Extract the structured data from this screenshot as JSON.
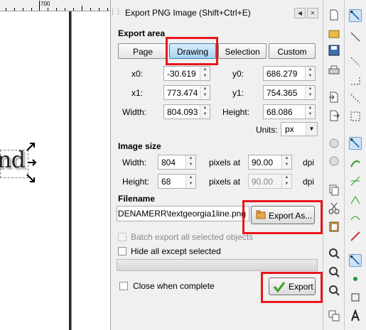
{
  "canvas": {
    "ruler_label": "700",
    "text": "nd"
  },
  "dialog": {
    "title": "Export PNG Image (Shift+Ctrl+E)",
    "export_area": {
      "heading": "Export area",
      "buttons": [
        "Page",
        "Drawing",
        "Selection",
        "Custom"
      ],
      "active": "Drawing",
      "x0_label": "x0:",
      "x0": "-30.619",
      "y0_label": "y0:",
      "y0": "686.279",
      "x1_label": "x1:",
      "x1": "773.474",
      "y1_label": "y1:",
      "y1": "754.365",
      "width_label": "Width:",
      "width": "804.093",
      "height_label": "Height:",
      "height": "68.086",
      "units_label": "Units:",
      "units": "px"
    },
    "image_size": {
      "heading": "Image size",
      "width_label": "Width:",
      "width": "804",
      "height_label": "Height:",
      "height": "68",
      "pixels_at_1": "pixels at",
      "dpi_x": "90.00",
      "dpi_1": "dpi",
      "pixels_at_2": "pixels at",
      "dpi_y": "90.00",
      "dpi_2": "dpi"
    },
    "filename": {
      "heading": "Filename",
      "value": "DENAMERR\\textgeorgia1line.png",
      "export_as": "Export As..."
    },
    "batch_label": "Batch export all selected objects",
    "hide_label": "Hide all except selected",
    "close_label": "Close when complete",
    "export_button": "Export"
  },
  "colors": {
    "highlight": "#e8161c",
    "active_button": "#a6d2f3"
  }
}
